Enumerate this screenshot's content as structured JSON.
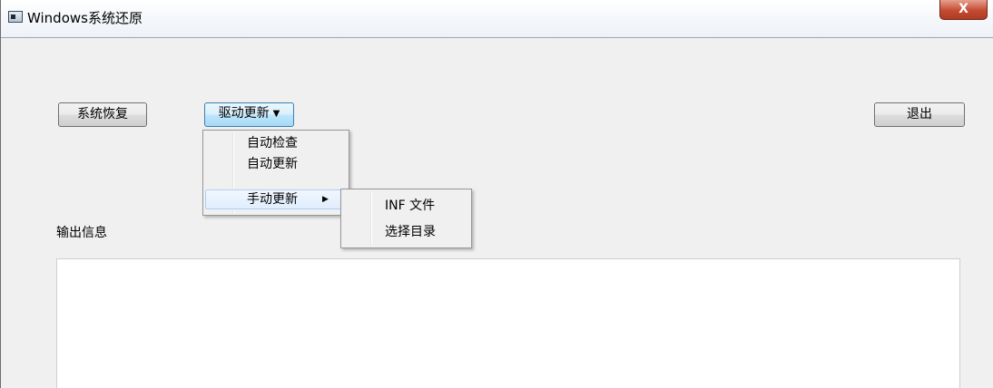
{
  "window": {
    "title": "Windows系统还原",
    "close_label": "X"
  },
  "toolbar": {
    "restore_label": "系统恢复",
    "driver_label": "驱动更新",
    "exit_label": "退出"
  },
  "driver_menu": {
    "items": [
      {
        "label": "自动检查"
      },
      {
        "label": "自动更新"
      },
      {
        "label": "手动更新",
        "has_submenu": true
      }
    ]
  },
  "manual_submenu": {
    "items": [
      {
        "label": "INF 文件"
      },
      {
        "label": "选择目录"
      }
    ]
  },
  "output": {
    "label": "输出信息",
    "text": ""
  }
}
